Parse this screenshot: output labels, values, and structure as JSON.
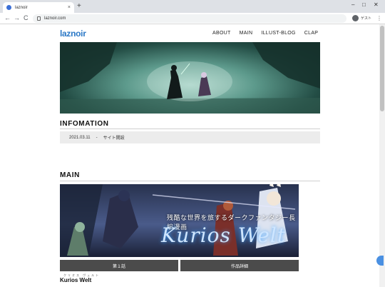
{
  "browser": {
    "tab_title": "laznoir",
    "tab_close": "×",
    "new_tab": "+",
    "back": "←",
    "forward": "→",
    "reload": "C",
    "url": "laznoir.com",
    "profile_label": "ゲスト",
    "menu": "⋮",
    "window_controls": {
      "minimize": "–",
      "maximize": "□",
      "close": "✕"
    }
  },
  "site": {
    "logo": "laznoir",
    "nav": [
      "ABOUT",
      "MAIN",
      "ILLUST-BLOG",
      "CLAP"
    ]
  },
  "infomation": {
    "heading": "INFOMATION",
    "items": [
      {
        "date": "2021.03.11",
        "sep": "-",
        "text": "サイト開設"
      }
    ]
  },
  "main": {
    "heading": "MAIN",
    "banner_subtitle": "残酷な世界を旅するダークファンタジー長編漫画",
    "banner_title": "Kurios Welt",
    "buttons": [
      "第１話",
      "作品詳細"
    ],
    "work_ruby": "クリオス ヴェルト",
    "work_title": "Kurios Welt"
  },
  "colors": {
    "logo": "#2b78c6",
    "button": "#4b4b4b",
    "news_bg": "#ececec"
  }
}
